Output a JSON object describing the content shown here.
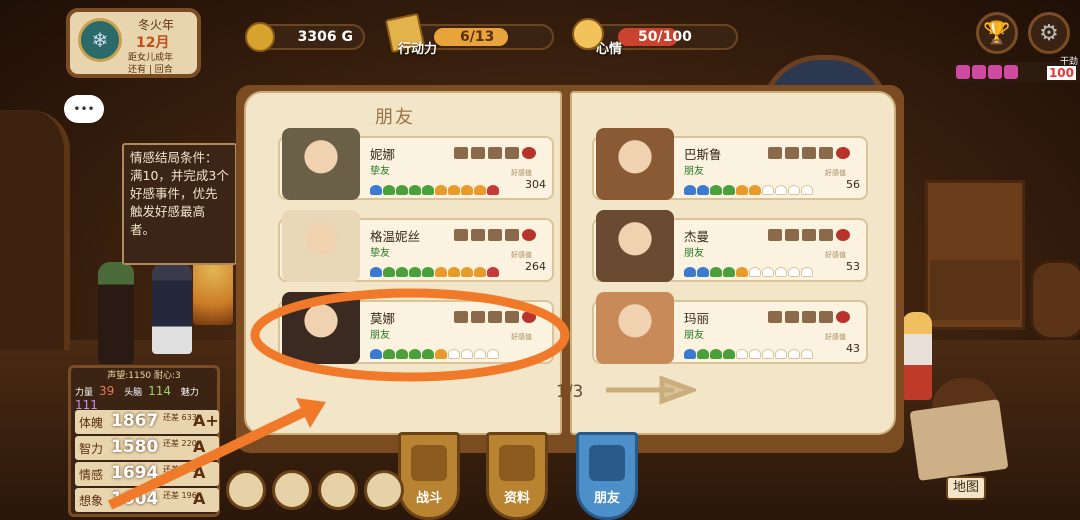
{
  "date": {
    "season": "冬火年",
    "month": "12月",
    "line1": "距女儿成年",
    "line2": "还有 | 回合"
  },
  "coins": {
    "value": "3306 G"
  },
  "action": {
    "label": "行动力",
    "value": "6/13"
  },
  "mood": {
    "label": "心情",
    "value": "50/100"
  },
  "affection": {
    "caption": "干劲",
    "value": "100"
  },
  "tooltip": {
    "text": "情感结局条件：满10，并完成3个好感事件，优先触发好感最高者。"
  },
  "stats": {
    "top": "声望:1150  耐心:3",
    "attrs": [
      {
        "label": "力量",
        "value": "39"
      },
      {
        "label": "头脑",
        "value": "114"
      },
      {
        "label": "魅力",
        "value": "111"
      }
    ],
    "rows": [
      {
        "name": "体魄",
        "value": "1867",
        "grade": "A+",
        "sub": "还差 633"
      },
      {
        "name": "智力",
        "value": "1580",
        "grade": "A",
        "sub": "还差 220"
      },
      {
        "name": "情感",
        "value": "1694",
        "grade": "A",
        "sub": "还差 106"
      },
      {
        "name": "想象",
        "value": "1604",
        "grade": "A",
        "sub": "还差 196"
      }
    ]
  },
  "book": {
    "title": "朋友",
    "page": "1/3",
    "fav_label": "好感值"
  },
  "friends": [
    {
      "name": "妮娜",
      "relation": "挚友",
      "value": "304",
      "hearts": [
        "b",
        "g",
        "g",
        "g",
        "g",
        "o",
        "o",
        "o",
        "o",
        "r"
      ],
      "color": "#6a6048"
    },
    {
      "name": "格温妮丝",
      "relation": "挚友",
      "value": "264",
      "hearts": [
        "b",
        "g",
        "g",
        "g",
        "g",
        "o",
        "o",
        "o",
        "o",
        "r"
      ],
      "color": "#e8d8b8"
    },
    {
      "name": "莫娜",
      "relation": "朋友",
      "value": "",
      "hearts": [
        "b",
        "g",
        "g",
        "g",
        "g",
        "o",
        "e",
        "e",
        "e",
        "e"
      ],
      "color": "#3a2a22"
    },
    {
      "name": "巴斯鲁",
      "relation": "朋友",
      "value": "56",
      "hearts": [
        "b",
        "b",
        "g",
        "g",
        "o",
        "o",
        "e",
        "e",
        "e",
        "e"
      ],
      "color": "#8a5a34"
    },
    {
      "name": "杰曼",
      "relation": "朋友",
      "value": "53",
      "hearts": [
        "b",
        "b",
        "g",
        "g",
        "o",
        "e",
        "e",
        "e",
        "e",
        "e"
      ],
      "color": "#6a4a30"
    },
    {
      "name": "玛丽",
      "relation": "朋友",
      "value": "43",
      "hearts": [
        "b",
        "g",
        "g",
        "g",
        "e",
        "e",
        "e",
        "e",
        "e",
        "e"
      ],
      "color": "#c98a5a"
    }
  ],
  "tabs": [
    {
      "label": "战斗",
      "active": false
    },
    {
      "label": "资料",
      "active": false
    },
    {
      "label": "朋友",
      "active": true
    }
  ],
  "map": {
    "label": "地图"
  },
  "colors": {
    "highlight": "#f07a2a",
    "heart_blue": "#3a7ad0",
    "heart_green": "#4aa03a",
    "heart_orange": "#e89a2a",
    "heart_red": "#c83a3a",
    "heart_empty": "#ffffff"
  }
}
